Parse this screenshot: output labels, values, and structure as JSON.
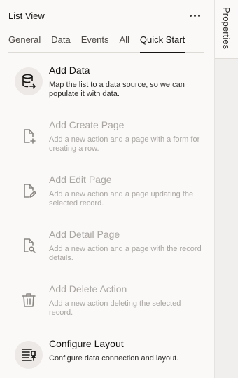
{
  "panel": {
    "title": "List View",
    "more_label": "More actions"
  },
  "tabs": [
    {
      "label": "General",
      "active": false
    },
    {
      "label": "Data",
      "active": false
    },
    {
      "label": "Events",
      "active": false
    },
    {
      "label": "All",
      "active": false
    },
    {
      "label": "Quick Start",
      "active": true
    }
  ],
  "quick_start": [
    {
      "icon": "database-icon",
      "title": "Add Data",
      "description": "Map the list to a data source, so we can populate it with data.",
      "enabled": true
    },
    {
      "icon": "add-page-icon",
      "title": "Add Create Page",
      "description": "Add a new action and a page with a form for creating a row.",
      "enabled": false
    },
    {
      "icon": "edit-page-icon",
      "title": "Add Edit Page",
      "description": "Add a new action and a page updating the selected record.",
      "enabled": false
    },
    {
      "icon": "detail-page-icon",
      "title": "Add Detail Page",
      "description": "Add a new action and a page with the record details.",
      "enabled": false
    },
    {
      "icon": "trash-icon",
      "title": "Add Delete Action",
      "description": "Add a new action deleting the selected record.",
      "enabled": false
    },
    {
      "icon": "layout-icon",
      "title": "Configure Layout",
      "description": "Configure data connection and layout.",
      "enabled": true
    }
  ],
  "side_rail": {
    "tab_label": "Properties"
  },
  "colors": {
    "active_text": "#161513",
    "disabled_text": "#a9a6a2",
    "icon_bg": "#ece9e6"
  }
}
